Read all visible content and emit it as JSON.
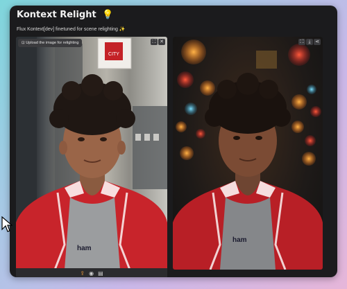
{
  "app": {
    "title": "Kontext Relight",
    "title_emoji": "💡",
    "subtitle": "Flux Kontext[dev] finetuned for scene relighting ✨"
  },
  "input_panel": {
    "upload_prompt": "Upload the image for relighting",
    "sign_text": "CITY",
    "tools": [
      "upload-icon",
      "webcam-icon",
      "clipboard-icon"
    ]
  },
  "output_panel": {
    "corner_icons": [
      "fullscreen-icon",
      "download-icon",
      "share-icon"
    ]
  },
  "shirt_text": "ham",
  "colors": {
    "app_bg": "#1b1b1d",
    "jacket": "#c8242b",
    "accent_orange": "#f39c3a"
  }
}
